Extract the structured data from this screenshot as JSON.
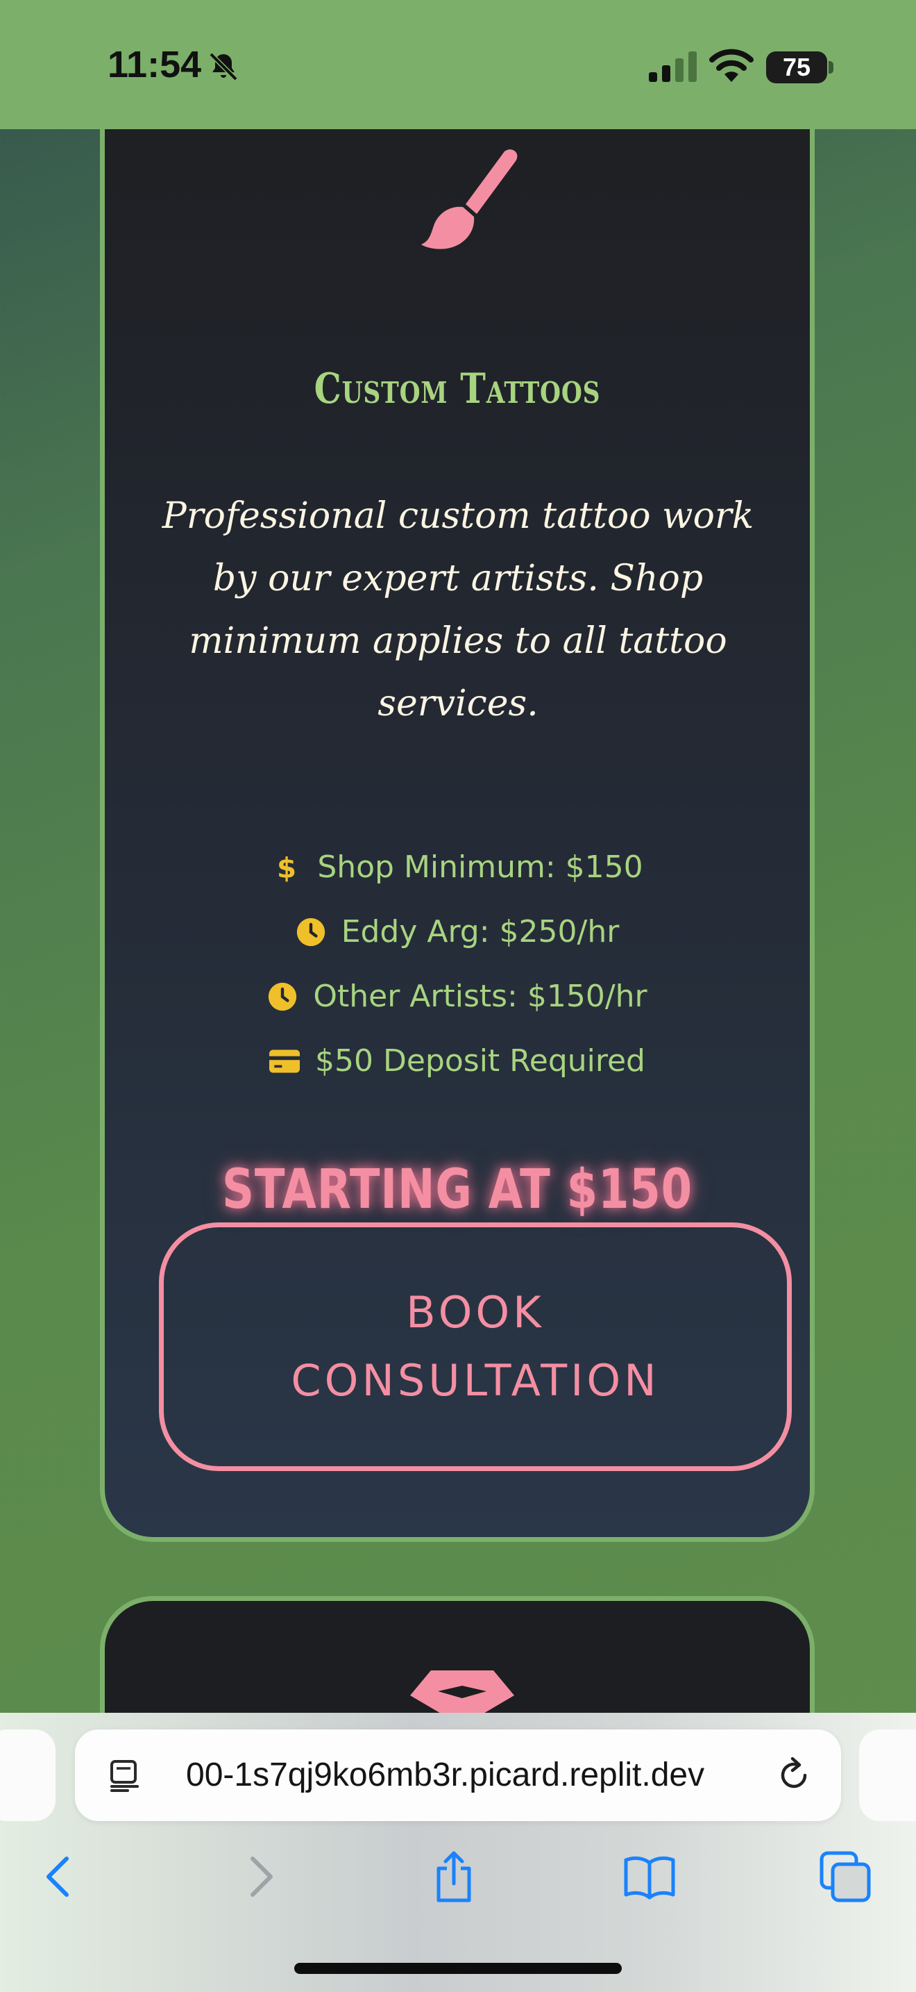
{
  "status_bar": {
    "time": "11:54",
    "battery": "75",
    "icons": [
      "bell-slash-icon",
      "cellular-signal-icon",
      "wifi-icon",
      "battery-icon"
    ]
  },
  "service_card": {
    "icon": "paintbrush-icon",
    "title": "Custom Tattoos",
    "description": "Professional custom tattoo work by our expert artists. Shop minimum applies to all tattoo services.",
    "details": [
      {
        "icon": "dollar-icon",
        "text": "Shop Minimum: $150"
      },
      {
        "icon": "clock-icon",
        "text": "Eddy Arg: $250/hr"
      },
      {
        "icon": "clock-icon",
        "text": "Other Artists: $150/hr"
      },
      {
        "icon": "credit-card-icon",
        "text": "$50 Deposit Required"
      }
    ],
    "price": "STARTING AT $150",
    "button_label": "BOOK CONSULTATION"
  },
  "next_card": {
    "icon": "gem-icon"
  },
  "browser": {
    "url": "00-1s7qj9ko6mb3r.picard.replit.dev",
    "toolbar": [
      "back-icon",
      "forward-icon",
      "share-icon",
      "bookmarks-icon",
      "tabs-icon"
    ]
  },
  "colors": {
    "accent_green": "#a8d480",
    "accent_pink": "#f48fa3",
    "icon_yellow": "#f0c02a",
    "card_border": "#7cb06a",
    "ios_blue": "#1a82fb"
  }
}
